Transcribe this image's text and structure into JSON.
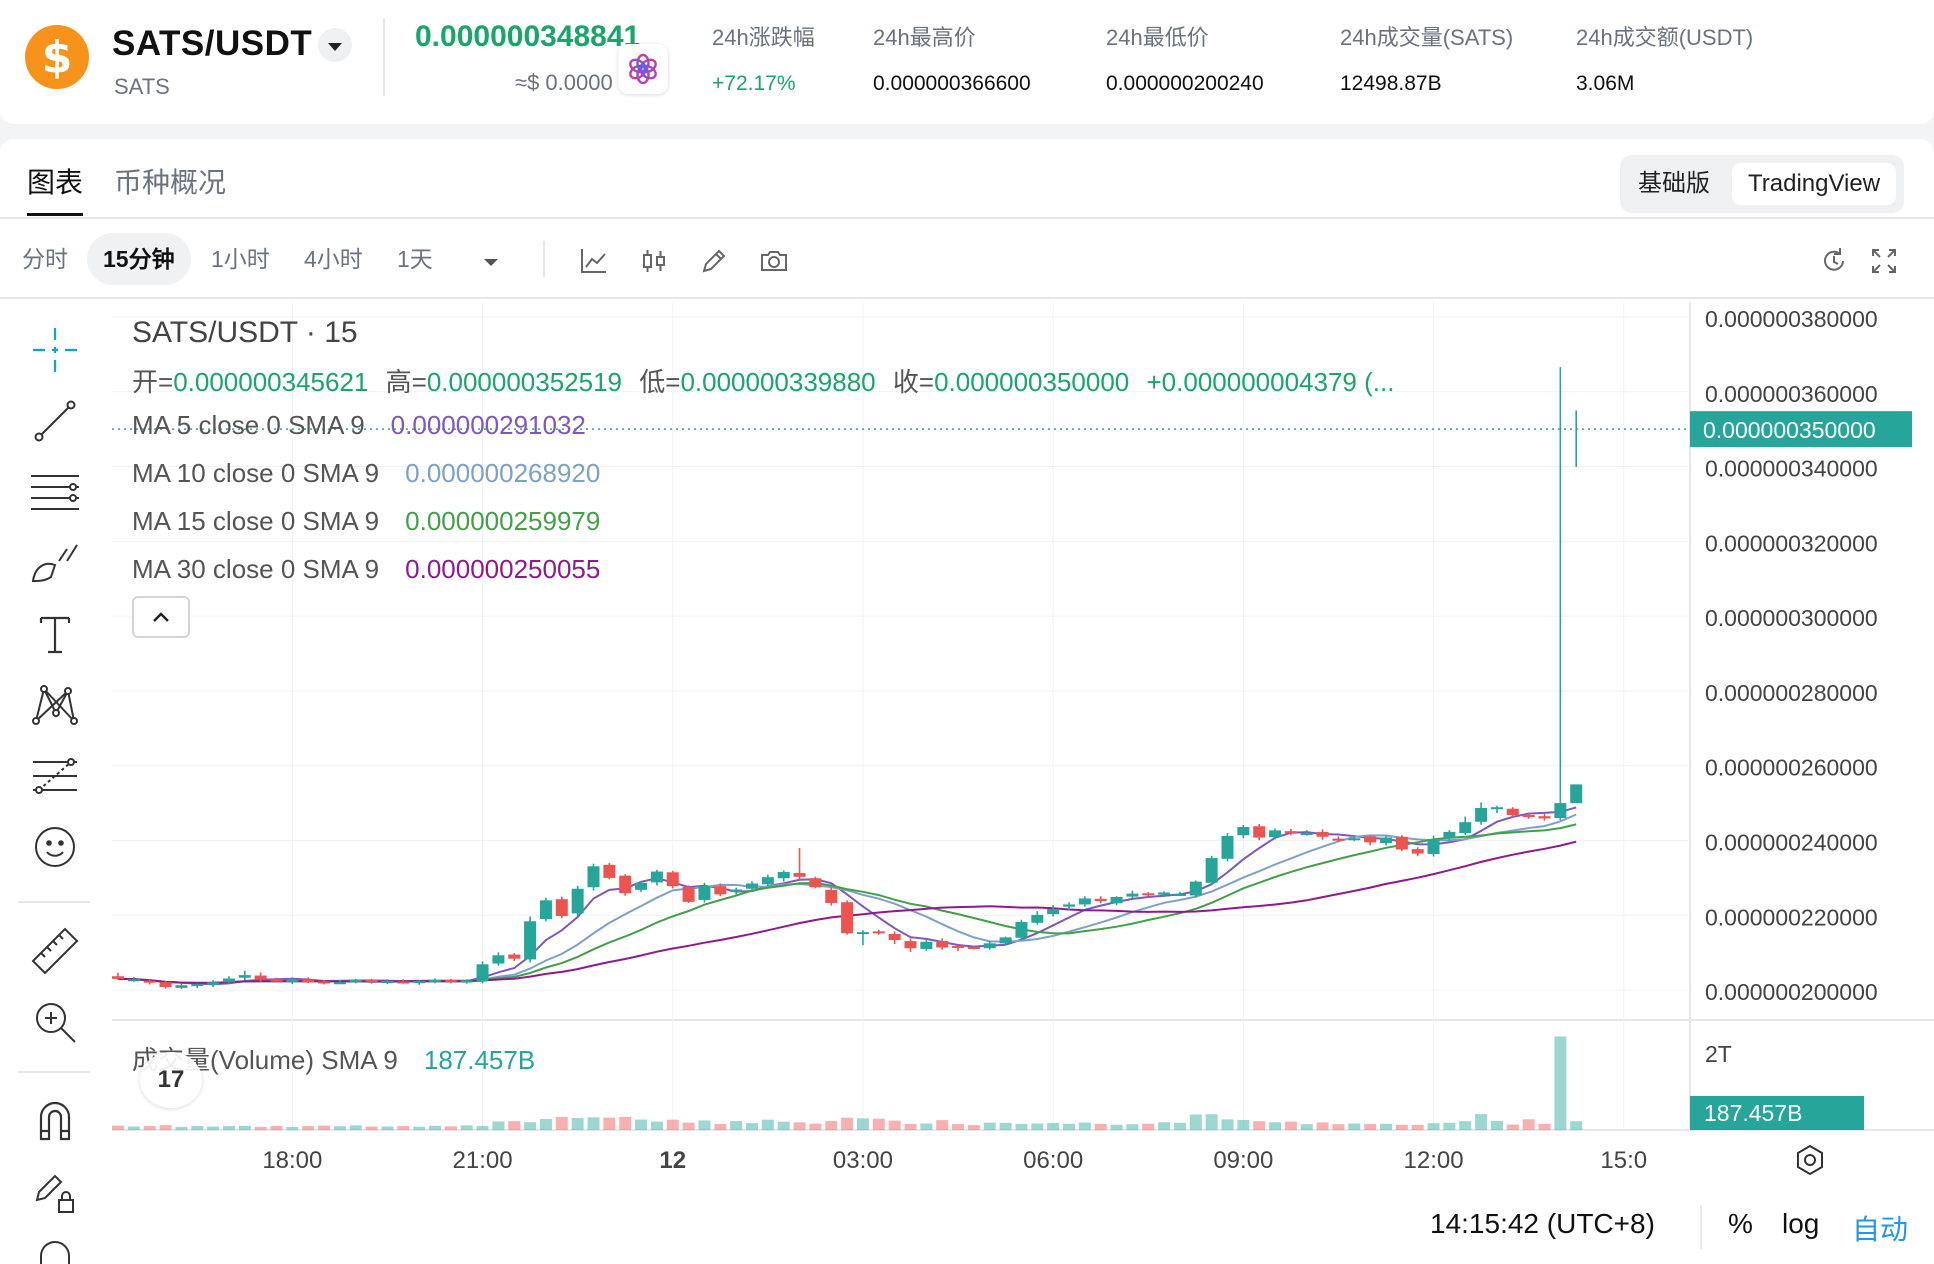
{
  "header": {
    "coin_symbol": "$",
    "pair": "SATS/USDT",
    "base": "SATS",
    "last_price": "0.000000348841",
    "usd_approx": "≈$ 0.0000",
    "stats": [
      {
        "label": "24h涨跌幅",
        "value": "+72.17%",
        "up": true
      },
      {
        "label": "24h最高价",
        "value": "0.000000366600"
      },
      {
        "label": "24h最低价",
        "value": "0.000000200240"
      },
      {
        "label": "24h成交量(SATS)",
        "value": "12498.87B"
      },
      {
        "label": "24h成交额(USDT)",
        "value": "3.06M"
      }
    ]
  },
  "tabs": {
    "chart": "图表",
    "overview": "币种概况"
  },
  "mode_toggle": {
    "basic": "基础版",
    "tradingview": "TradingView"
  },
  "timeframes": [
    "分时",
    "15分钟",
    "1小时",
    "4小时",
    "1天"
  ],
  "selected_timeframe": "15分钟",
  "chart": {
    "symbol_title": "SATS/USDT · 15",
    "ohlc": {
      "open_label": "开=",
      "open": "0.000000345621",
      "high_label": "高=",
      "high": "0.000000352519",
      "low_label": "低=",
      "low": "0.000000339880",
      "close_label": "收=",
      "close": "0.000000350000",
      "change": "+0.000000004379 (..."
    },
    "ma": [
      {
        "label": "MA 5 close 0 SMA 9",
        "value": "0.000000291032",
        "color": "#7e57c2"
      },
      {
        "label": "MA 10 close 0 SMA 9",
        "value": "0.000000268920",
        "color": "#7ea1c9"
      },
      {
        "label": "MA 15 close 0 SMA 9",
        "value": "0.000000259979",
        "color": "#43a047"
      },
      {
        "label": "MA 30 close 0 SMA 9",
        "value": "0.000000250055",
        "color": "#8e1a8e"
      }
    ],
    "volume_label": "成交量(Volume) SMA 9",
    "volume_value": "187.457B",
    "volume_axis_top": "2T",
    "y_ticks": [
      "0.000000380000",
      "0.000000360000",
      "0.000000340000",
      "0.000000320000",
      "0.000000300000",
      "0.000000280000",
      "0.000000260000",
      "0.000000240000",
      "0.000000220000",
      "0.000000200000"
    ],
    "x_ticks": [
      "18:00",
      "21:00",
      "12",
      "03:00",
      "06:00",
      "09:00",
      "12:00",
      "15:0"
    ],
    "price_tag": "0.000000350000",
    "clock": "14:15:42 (UTC+8)",
    "scale_buttons": {
      "percent": "%",
      "log": "log",
      "auto": "自动"
    },
    "up_color": "#26a69a",
    "down_color": "#ef5350",
    "badge_number": "17"
  },
  "chart_data": {
    "type": "candlestick",
    "title": "SATS/USDT · 15",
    "ylim": [
      1.92e-07,
      3.84e-07
    ],
    "x": [
      "15:15",
      "15:30",
      "15:45",
      "16:00",
      "16:15",
      "16:30",
      "16:45",
      "17:00",
      "17:15",
      "17:30",
      "17:45",
      "18:00",
      "18:15",
      "18:30",
      "18:45",
      "19:00",
      "19:15",
      "19:30",
      "19:45",
      "20:00",
      "20:15",
      "20:30",
      "20:45",
      "21:00",
      "21:15",
      "21:30",
      "21:45",
      "22:00",
      "22:15",
      "22:30",
      "22:45",
      "23:00",
      "23:15",
      "23:30",
      "23:45",
      "00:00",
      "00:15",
      "00:30",
      "00:45",
      "01:00",
      "01:15",
      "01:30",
      "01:45",
      "02:00",
      "02:15",
      "02:30",
      "02:45",
      "03:00",
      "03:15",
      "03:30",
      "03:45",
      "04:00",
      "04:15",
      "04:30",
      "04:45",
      "05:00",
      "05:15",
      "05:30",
      "05:45",
      "06:00",
      "06:15",
      "06:30",
      "06:45",
      "07:00",
      "07:15",
      "07:30",
      "07:45",
      "08:00",
      "08:15",
      "08:30",
      "08:45",
      "09:00",
      "09:15",
      "09:30",
      "09:45",
      "10:00",
      "10:15",
      "10:30",
      "10:45",
      "11:00",
      "11:15",
      "11:30",
      "11:45",
      "12:00",
      "12:15",
      "12:30",
      "12:45",
      "13:00",
      "13:15",
      "13:30",
      "13:45",
      "14:00",
      "14:15"
    ],
    "open": [
      0.2037,
      0.2029,
      0.2025,
      0.2021,
      0.2006,
      0.2011,
      0.2014,
      0.2021,
      0.2033,
      0.2039,
      0.2028,
      0.2023,
      0.2028,
      0.2023,
      0.2021,
      0.2023,
      0.2027,
      0.2022,
      0.2023,
      0.202,
      0.2025,
      0.2027,
      0.202,
      0.2024,
      0.2071,
      0.2095,
      0.2082,
      0.219,
      0.2243,
      0.2205,
      0.2275,
      0.2335,
      0.2306,
      0.2268,
      0.2288,
      0.2315,
      0.2276,
      0.2241,
      0.2278,
      0.2262,
      0.2271,
      0.2283,
      0.2299,
      0.2313,
      0.2299,
      0.2268,
      0.2235,
      0.2154,
      0.2157,
      0.215,
      0.2131,
      0.211,
      0.2131,
      0.2118,
      0.2115,
      0.2112,
      0.2125,
      0.214,
      0.218,
      0.2203,
      0.2223,
      0.2229,
      0.2244,
      0.2232,
      0.225,
      0.2259,
      0.2255,
      0.2256,
      0.2253,
      0.2287,
      0.2351,
      0.2414,
      0.2438,
      0.2409,
      0.2425,
      0.2419,
      0.2423,
      0.2405,
      0.2404,
      0.2411,
      0.2393,
      0.241,
      0.2377,
      0.2364,
      0.2405,
      0.242,
      0.245,
      0.2486,
      0.2485,
      0.2468,
      0.2465,
      0.246,
      0.25
    ],
    "close": [
      0.203,
      0.2029,
      0.202,
      0.2008,
      0.2013,
      0.2016,
      0.2021,
      0.2031,
      0.204,
      0.2029,
      0.2024,
      0.2027,
      0.2021,
      0.2021,
      0.2021,
      0.2027,
      0.2022,
      0.2024,
      0.202,
      0.2024,
      0.2027,
      0.2023,
      0.2026,
      0.2069,
      0.2093,
      0.2084,
      0.2184,
      0.224,
      0.2198,
      0.2271,
      0.2331,
      0.23,
      0.2259,
      0.2287,
      0.2317,
      0.2278,
      0.2236,
      0.2278,
      0.2256,
      0.2269,
      0.2285,
      0.2302,
      0.2316,
      0.2303,
      0.2275,
      0.2233,
      0.2152,
      0.2155,
      0.2154,
      0.2134,
      0.2112,
      0.2129,
      0.2114,
      0.2114,
      0.2113,
      0.2125,
      0.2141,
      0.2182,
      0.2201,
      0.2217,
      0.2229,
      0.2245,
      0.2238,
      0.2249,
      0.2258,
      0.2255,
      0.2261,
      0.2257,
      0.229,
      0.2353,
      0.2412,
      0.2436,
      0.2408,
      0.2427,
      0.2421,
      0.242,
      0.241,
      0.2402,
      0.2406,
      0.2395,
      0.2408,
      0.2376,
      0.2365,
      0.2404,
      0.2423,
      0.2449,
      0.2487,
      0.2489,
      0.2468,
      0.2466,
      0.2459,
      0.25,
      0.255
    ],
    "high": [
      0.2046,
      0.2035,
      0.203,
      0.2025,
      0.2017,
      0.2018,
      0.2027,
      0.2037,
      0.2052,
      0.2047,
      0.2033,
      0.2034,
      0.2034,
      0.2027,
      0.2027,
      0.203,
      0.203,
      0.2029,
      0.2029,
      0.2026,
      0.2031,
      0.203,
      0.2029,
      0.2077,
      0.2101,
      0.2099,
      0.2197,
      0.2247,
      0.225,
      0.2279,
      0.2338,
      0.234,
      0.231,
      0.2292,
      0.2322,
      0.2319,
      0.228,
      0.2287,
      0.2285,
      0.2274,
      0.2291,
      0.2309,
      0.232,
      0.238,
      0.2303,
      0.2275,
      0.224,
      0.216,
      0.2161,
      0.2157,
      0.2138,
      0.2135,
      0.2138,
      0.212,
      0.2118,
      0.2132,
      0.2143,
      0.2188,
      0.2211,
      0.2227,
      0.2235,
      0.2251,
      0.2251,
      0.2251,
      0.2266,
      0.2262,
      0.2264,
      0.2263,
      0.2293,
      0.2359,
      0.242,
      0.2442,
      0.2444,
      0.2432,
      0.2431,
      0.2428,
      0.243,
      0.2411,
      0.2413,
      0.2414,
      0.2414,
      0.2414,
      0.2382,
      0.2413,
      0.2428,
      0.2464,
      0.2502,
      0.2493,
      0.2489,
      0.2475,
      0.2471,
      0.3666,
      0.355
    ],
    "low": [
      0.2027,
      0.2022,
      0.2015,
      0.2004,
      0.2003,
      0.2005,
      0.2008,
      0.2018,
      0.2027,
      0.2022,
      0.202,
      0.2016,
      0.2019,
      0.2015,
      0.2016,
      0.2018,
      0.2017,
      0.2016,
      0.2017,
      0.2014,
      0.2018,
      0.2018,
      0.2017,
      0.2018,
      0.2065,
      0.2078,
      0.2074,
      0.2184,
      0.2192,
      0.2198,
      0.2266,
      0.2296,
      0.2252,
      0.2262,
      0.228,
      0.2272,
      0.2233,
      0.2234,
      0.2251,
      0.2256,
      0.2263,
      0.2278,
      0.229,
      0.2296,
      0.2272,
      0.2226,
      0.2148,
      0.212,
      0.2148,
      0.2123,
      0.2102,
      0.2105,
      0.2108,
      0.2104,
      0.2109,
      0.2108,
      0.2119,
      0.2134,
      0.2175,
      0.2197,
      0.2214,
      0.2223,
      0.2232,
      0.2227,
      0.2244,
      0.2249,
      0.2249,
      0.2252,
      0.2247,
      0.228,
      0.2344,
      0.2406,
      0.2401,
      0.2403,
      0.2414,
      0.2413,
      0.2402,
      0.2396,
      0.2398,
      0.2387,
      0.2387,
      0.2372,
      0.2358,
      0.2357,
      0.2398,
      0.2415,
      0.2442,
      0.2473,
      0.2462,
      0.2458,
      0.2453,
      0.2454,
      0.3399
    ],
    "volume": [
      3.2,
      2.6,
      2.9,
      3.6,
      2.3,
      3.0,
      2.5,
      2.9,
      3.1,
      2.3,
      3.0,
      2.2,
      2.9,
      3.2,
      2.8,
      3.4,
      2.5,
      2.6,
      2.9,
      2.4,
      3.1,
      2.7,
      3.4,
      2.9,
      6.3,
      6.5,
      5.7,
      8.1,
      9.6,
      8.8,
      9.3,
      9.1,
      9.6,
      7.7,
      6.2,
      7.6,
      5.4,
      7.0,
      4.4,
      6.6,
      5.1,
      7.6,
      6.1,
      5.6,
      4.6,
      6.7,
      9.0,
      8.6,
      8.3,
      6.9,
      4.5,
      4.8,
      7.3,
      4.4,
      3.6,
      5.4,
      5.3,
      4.5,
      4.8,
      5.2,
      4.6,
      5.5,
      4.5,
      3.9,
      4.3,
      4.6,
      5.7,
      5.3,
      11.4,
      11.6,
      7.8,
      7.4,
      6.5,
      5.7,
      6.2,
      4.3,
      5.6,
      4.3,
      4.8,
      4.5,
      4.6,
      3.8,
      3.8,
      5.0,
      5.3,
      6.5,
      11.7,
      6.7,
      4.0,
      7.9,
      4.4,
      68.8,
      6.5
    ],
    "volume_unit": "B",
    "price_unit": "1e-6 USDT"
  }
}
